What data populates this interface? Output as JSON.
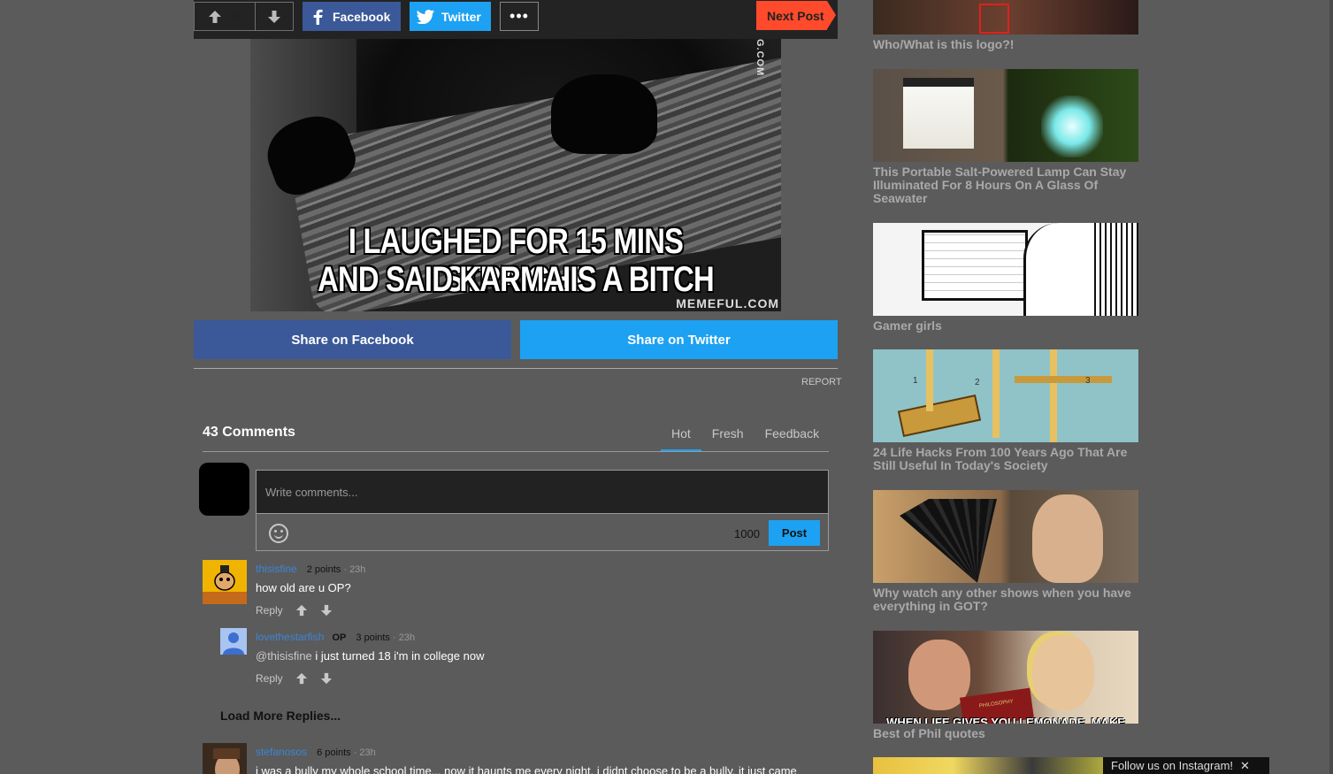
{
  "topbar": {
    "upvote_label": "UP",
    "facebook_label": "Facebook",
    "twitter_label": "Twitter",
    "more_label": "•••",
    "next_label": "Next Post"
  },
  "meme": {
    "caption_line1": "I LAUGHED FOR 15 MINS STRAIGHT",
    "caption_line2": "AND SAID KARMA IS A BITCH",
    "watermark_side": "G.COM",
    "watermark_bottom": "MEMEFUL.COM"
  },
  "share": {
    "facebook": "Share on Facebook",
    "twitter": "Share on Twitter",
    "report": "REPORT"
  },
  "comments": {
    "count_label": "43 Comments",
    "tabs": [
      "Hot",
      "Fresh",
      "Feedback"
    ],
    "input_placeholder": "Write comments...",
    "char_limit": "1000",
    "post_label": "Post",
    "load_more": "Load More Replies...",
    "items": [
      {
        "user": "thisisfine",
        "op": "",
        "points": "2 points",
        "time": "· 23h",
        "text": "how old are u OP?",
        "reply": "Reply"
      },
      {
        "user": "lovethestarfish",
        "op": "OP",
        "points": "3 points",
        "time": "· 23h",
        "mention": "@thisisfine",
        "text": " i just turned 18 i'm in college now",
        "reply": "Reply"
      },
      {
        "user": "stefanosos",
        "op": "",
        "points": "6 points",
        "time": "· 23h",
        "text": "i was a bully my whole school time... now it haunts me every night. i didnt choose to be a bully, it just came"
      }
    ]
  },
  "sidebar": [
    {
      "title": "Who/What is this logo?!"
    },
    {
      "title": "This Portable Salt-Powered Lamp Can Stay Illuminated For 8 Hours On A Glass Of Seawater"
    },
    {
      "title": "Gamer girls"
    },
    {
      "title": "24 Life Hacks From 100 Years Ago That Are Still Useful In Today's Society"
    },
    {
      "title": "Why watch any other shows when you have everything in GOT?"
    },
    {
      "title": "Best of Phil quotes",
      "thumb_text": "WHEN LIFE GIVES YOU LEMONADE, MAKE"
    }
  ],
  "knot_numbers": [
    "1",
    "2",
    "3"
  ],
  "book_label": "PHILOSOPHY",
  "instagram": {
    "label": "Follow us on Instagram!",
    "close": "✕"
  },
  "colors": {
    "facebook": "#3b5998",
    "twitter": "#1da1f2",
    "next": "#ff4a2b",
    "link": "#3d84d6"
  }
}
